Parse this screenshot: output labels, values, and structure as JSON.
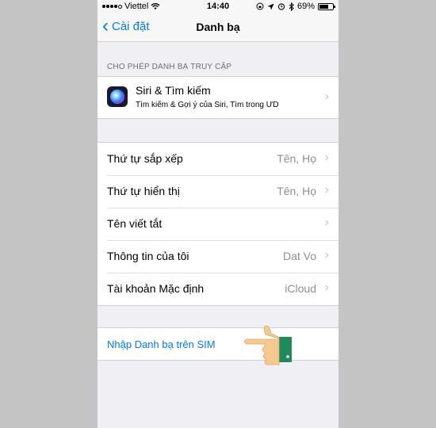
{
  "status_bar": {
    "carrier": "Viettel",
    "time": "14:40",
    "battery": "69%",
    "battery_level": 0.69
  },
  "nav": {
    "back_label": "Cài đặt",
    "title": "Danh bạ"
  },
  "section_header": "CHO PHÉP DANH BẠ TRUY CẬP",
  "siri": {
    "title": "Siri & Tìm kiếm",
    "subtitle": "Tìm kiếm & Gợi ý của Siri, Tìm trong ƯD"
  },
  "settings": [
    {
      "label": "Thứ tự sắp xếp",
      "value": "Tên, Họ"
    },
    {
      "label": "Thứ tự hiển thị",
      "value": "Tên, Họ"
    },
    {
      "label": "Tên viết tắt",
      "value": ""
    },
    {
      "label": "Thông tin của tôi",
      "value": "Dat Vo"
    },
    {
      "label": "Tài khoản Mặc định",
      "value": "iCloud"
    }
  ],
  "import_sim_label": "Nhập Danh bạ trên SIM",
  "colors": {
    "accent": "#007aff",
    "background": "#efeff4",
    "secondary_text": "#8e8e93",
    "chevron": "#c7c7cc"
  },
  "icons": [
    "signal-icon",
    "wifi-icon",
    "lock-rotation-icon",
    "location-icon",
    "alarm-icon",
    "bluetooth-icon",
    "battery-icon",
    "back-chevron-icon",
    "siri-icon",
    "chevron-right-icon",
    "pointing-hand-icon"
  ]
}
